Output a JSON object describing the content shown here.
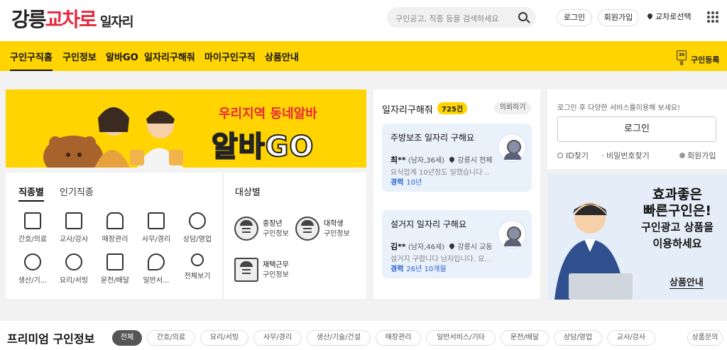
{
  "header": {
    "logo_part1": "강릉",
    "logo_part2": "교차로",
    "logo_part3": "일자리",
    "search_placeholder": "구인공고, 직종 등을 검색하세요",
    "login": "로그인",
    "signup": "회원가입",
    "region": "교차로선택"
  },
  "nav": {
    "tabs": [
      "구인구직홈",
      "구인정보",
      "알바GO",
      "일자리구해줘",
      "마이구인구직",
      "상품안내"
    ],
    "register": "구인등록",
    "register_badge": "30일"
  },
  "banner": {
    "line1": "우리지역 동네알바",
    "line2": "알바GO"
  },
  "jobs": {
    "tab_active": "직종별",
    "tab_other": "인기직종",
    "categories": [
      "간호/의료",
      "교사/강사",
      "매장관리",
      "사무/경리",
      "상담/영업",
      "생산/기...",
      "요리/서빙",
      "운전/배달",
      "일반서...",
      "전체보기"
    ],
    "target_title": "대상별",
    "targets": [
      {
        "t1": "중장년",
        "t2": "구인정보"
      },
      {
        "t1": "대학생",
        "t2": "구인정보"
      },
      {
        "t1": "재택근무",
        "t2": "구인정보"
      }
    ]
  },
  "help": {
    "title": "일자리구해줘",
    "count": "725건",
    "consult": "의뢰하기",
    "cards": [
      {
        "title": "주방보조 일자리 구해요",
        "name": "최**",
        "info": "(남자,36세)",
        "loc": "강릉시 전체",
        "desc": "요식업계 10년정도 일했습니다 ...",
        "exp_label": "경력",
        "exp": "10년"
      },
      {
        "title": "설거지 일자리 구해요",
        "name": "김**",
        "info": "(남자,46세)",
        "loc": "강릉시 교동",
        "desc": "설거지 구합니다 남자입니다. 요...",
        "exp_label": "경력",
        "exp": "26년 10개월"
      }
    ]
  },
  "login": {
    "prompt": "로그인 후 다양한 서비스를이용해 보세요!",
    "button": "로그인",
    "find_id": "ID찾기",
    "find_pw": "비밀번호찾기",
    "join": "회원가입"
  },
  "ad": {
    "line1": "효과좋은",
    "line2": "빠른구인은!",
    "line3": "구인광고 상품을",
    "line4": "이용하세요",
    "button": "상품안내"
  },
  "premium": {
    "title": "프리미엄 구인정보",
    "chips": [
      "전체",
      "간호/의료",
      "요리/서빙",
      "사무/경리",
      "생산/기술/건설",
      "매장관리",
      "일반서비스/기타",
      "운전/배달",
      "상담/영업",
      "교사/강사"
    ],
    "more": "상품문의"
  }
}
